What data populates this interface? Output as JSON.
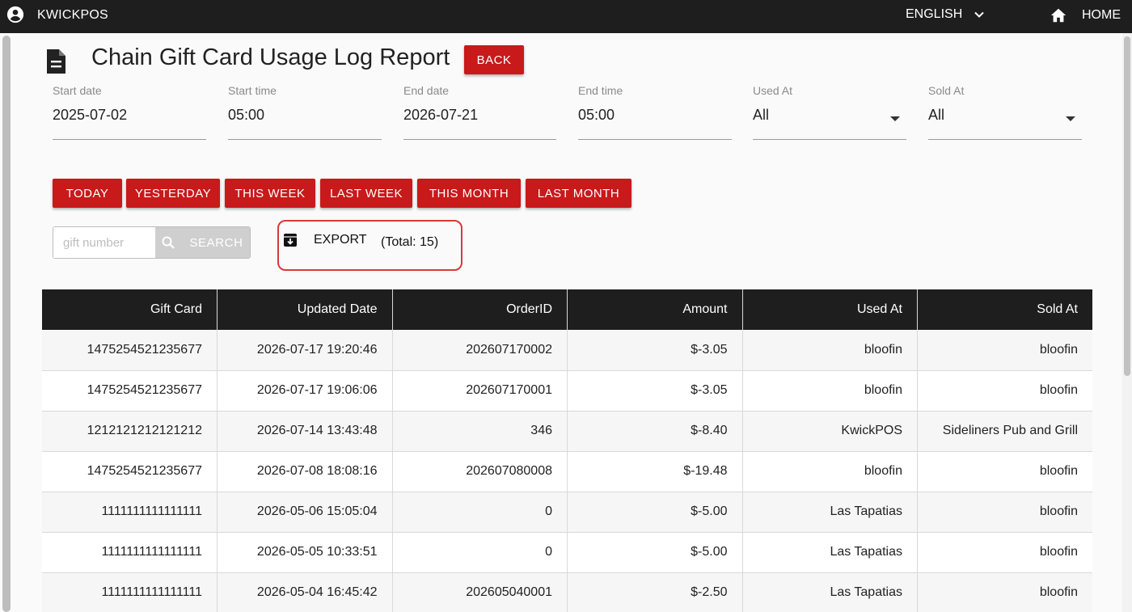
{
  "app": {
    "brand": "KWICKPOS",
    "language": "ENGLISH",
    "home_label": "HOME"
  },
  "page": {
    "title": "Chain Gift Card Usage Log Report",
    "back_label": "BACK"
  },
  "filters": {
    "start_date": {
      "label": "Start date",
      "value": "2025-07-02"
    },
    "start_time": {
      "label": "Start time",
      "value": "05:00"
    },
    "end_date": {
      "label": "End date",
      "value": "2026-07-21"
    },
    "end_time": {
      "label": "End time",
      "value": "05:00"
    },
    "used_at": {
      "label": "Used At",
      "value": "All"
    },
    "sold_at": {
      "label": "Sold At",
      "value": "All"
    }
  },
  "quick_ranges": [
    "TODAY",
    "YESTERDAY",
    "THIS WEEK",
    "LAST WEEK",
    "THIS MONTH",
    "LAST MONTH"
  ],
  "search": {
    "placeholder": "gift number",
    "button_label": "SEARCH"
  },
  "export": {
    "label": "EXPORT",
    "total": "(Total: 15)"
  },
  "table": {
    "columns": [
      "Gift Card",
      "Updated Date",
      "OrderID",
      "Amount",
      "Used At",
      "Sold At"
    ],
    "rows": [
      [
        "1475254521235677",
        "2026-07-17 19:20:46",
        "202607170002",
        "$-3.05",
        "bloofin",
        "bloofin"
      ],
      [
        "1475254521235677",
        "2026-07-17 19:06:06",
        "202607170001",
        "$-3.05",
        "bloofin",
        "bloofin"
      ],
      [
        "1212121212121212",
        "2026-07-14 13:43:48",
        "346",
        "$-8.40",
        "KwickPOS",
        "Sideliners Pub and Grill"
      ],
      [
        "1475254521235677",
        "2026-07-08 18:08:16",
        "202607080008",
        "$-19.48",
        "bloofin",
        "bloofin"
      ],
      [
        "1111111111111111",
        "2026-05-06 15:05:04",
        "0",
        "$-5.00",
        "Las Tapatias",
        "bloofin"
      ],
      [
        "1111111111111111",
        "2026-05-05 10:33:51",
        "0",
        "$-5.00",
        "Las Tapatias",
        "bloofin"
      ],
      [
        "1111111111111111",
        "2026-05-04 16:45:42",
        "202605040001",
        "$-2.50",
        "Las Tapatias",
        "bloofin"
      ]
    ]
  },
  "colors": {
    "accent": "#c8191b",
    "topbar": "#1e1e1e",
    "header": "#1e1e1e",
    "highlight_border": "#d83a3a"
  }
}
